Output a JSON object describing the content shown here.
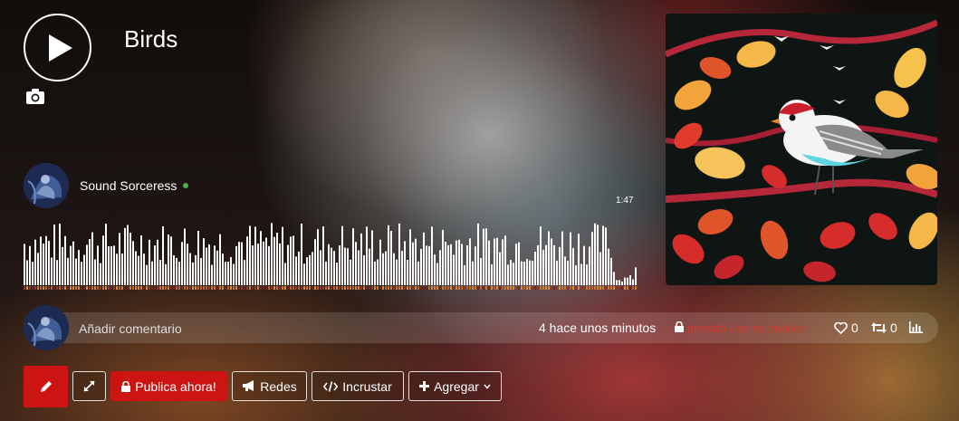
{
  "track": {
    "title": "Birds",
    "duration": "1:47"
  },
  "artist": {
    "name": "Sound Sorceress",
    "online": true
  },
  "comment": {
    "placeholder": "Añadir comentario"
  },
  "stats": {
    "time_ago": "4 hace unos minutos",
    "privacy": "privado / no es público",
    "likes": "0",
    "reposts": "0"
  },
  "actions": {
    "publish": "Publica ahora!",
    "networks": "Redes",
    "embed": "Incrustar",
    "add": "Agregar"
  },
  "icons": {
    "play": "play-icon",
    "camera": "camera-icon",
    "edit": "pencil-icon",
    "expand": "expand-icon",
    "lock": "lock-icon",
    "megaphone": "bullhorn-icon",
    "code": "code-icon",
    "plus": "plus-icon",
    "caret": "chevron-down-icon",
    "heart": "heart-icon",
    "repost": "retweet-icon",
    "stats": "bar-chart-icon"
  },
  "colors": {
    "accent": "#cc1412",
    "private": "#d03b2c",
    "online": "#4cae4c"
  }
}
